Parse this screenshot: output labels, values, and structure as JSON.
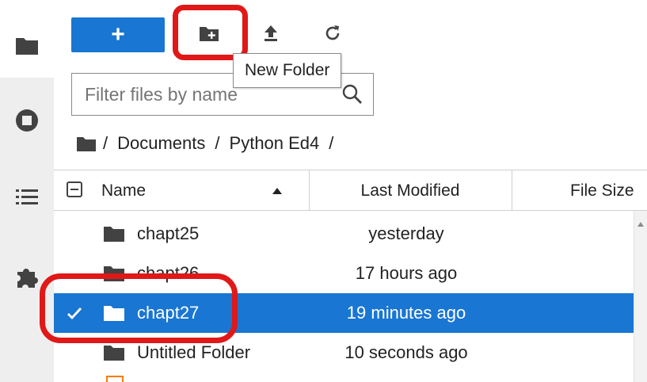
{
  "sidebar": {
    "items": [
      {
        "name": "file-browser",
        "icon": "folder-icon"
      },
      {
        "name": "running",
        "icon": "stop-circle-icon"
      },
      {
        "name": "table-of-contents",
        "icon": "list-icon"
      },
      {
        "name": "extensions",
        "icon": "puzzle-icon"
      }
    ]
  },
  "toolbar": {
    "new_label": "+",
    "new_folder_icon": "new-folder-icon",
    "upload_icon": "upload-icon",
    "refresh_icon": "refresh-icon",
    "tooltip": "New Folder"
  },
  "filter": {
    "placeholder": "Filter files by name"
  },
  "breadcrumb": {
    "parts": [
      "/",
      "Documents",
      "/",
      "Python Ed4",
      "/"
    ]
  },
  "columns": {
    "name": "Name",
    "last_modified": "Last Modified",
    "file_size": "File Size"
  },
  "files": [
    {
      "name": "chapt25",
      "modified": "yesterday",
      "selected": false
    },
    {
      "name": "chapt26",
      "modified": "17 hours ago",
      "selected": false
    },
    {
      "name": "chapt27",
      "modified": "19 minutes ago",
      "selected": true
    },
    {
      "name": "Untitled Folder",
      "modified": "10 seconds ago",
      "selected": false
    }
  ],
  "colors": {
    "accent": "#1976d2",
    "annotation": "#e01818",
    "folder": "#424242"
  }
}
